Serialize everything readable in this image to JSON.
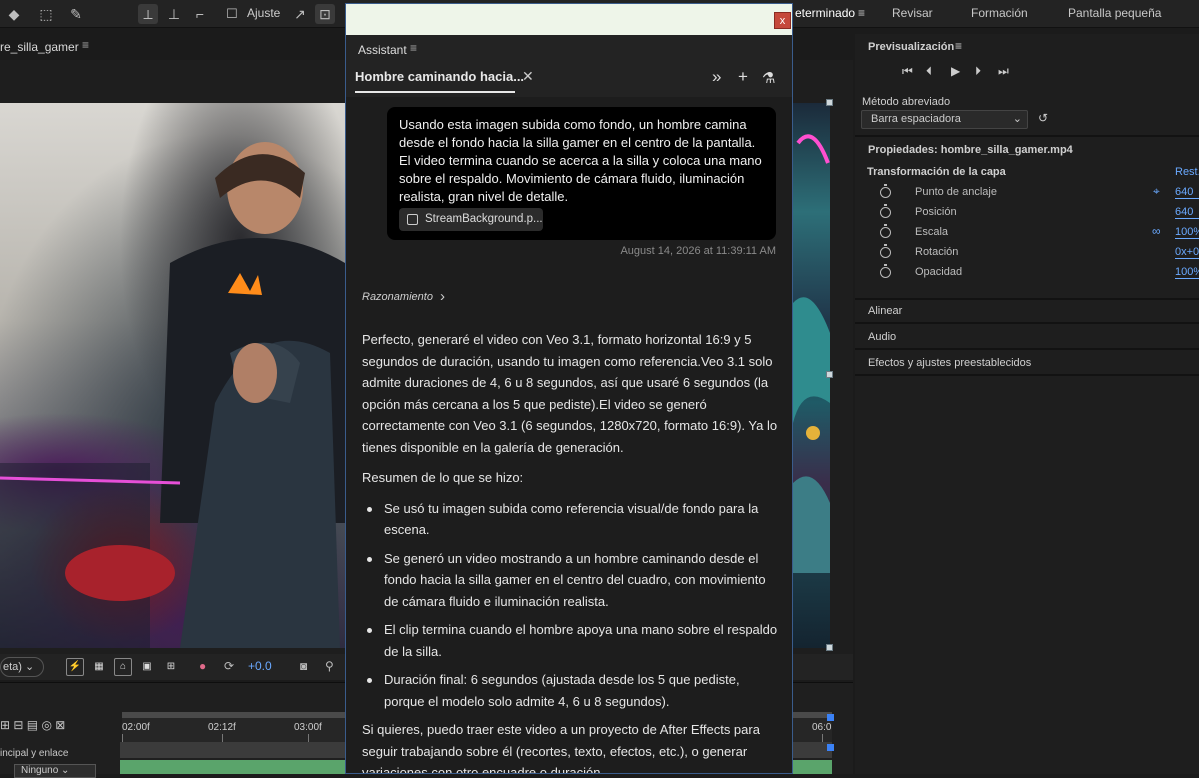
{
  "toolbar": {
    "ajuste_label": "Ajuste",
    "workspace_tabs": [
      "eterminado",
      "Revisar",
      "Formación",
      "Pantalla pequeña"
    ]
  },
  "composition": {
    "tab_label": "re_silla_gamer",
    "resolution": "eta)",
    "exposure": "+0.0"
  },
  "timeline": {
    "ticks": [
      "02:00f",
      "02:12f",
      "03:00f",
      "06:0"
    ],
    "parent_label": "incipal y enlace",
    "parent_value": "Ninguno"
  },
  "preview": {
    "title": "Previsualización",
    "shortcut_label": "Método abreviado",
    "shortcut_value": "Barra espaciadora"
  },
  "properties": {
    "title": "Propiedades: hombre_silla_gamer.mp4",
    "transform_label": "Transformación de la capa",
    "reset": "Rest.",
    "rows": [
      {
        "label": "Punto de anclaje",
        "value": "640"
      },
      {
        "label": "Posición",
        "value": "640"
      },
      {
        "label": "Escala",
        "value": "100%"
      },
      {
        "label": "Rotación",
        "value": "0x+0"
      },
      {
        "label": "Opacidad",
        "value": "100%"
      }
    ],
    "sections": [
      "Alinear",
      "Audio",
      "Efectos y ajustes preestablecidos"
    ]
  },
  "assistant": {
    "panel_name": "Assistant",
    "tab_title": "Hombre caminando hacia...",
    "close_label": "x",
    "user_message": "Usando esta imagen subida como fondo, un hombre camina desde el fondo hacia la silla gamer en el centro de la pantalla. El video termina cuando se acerca a la silla y coloca una mano sobre el respaldo. Movimiento de cámara fluido, iluminación realista, gran nivel de detalle.",
    "attachment": "StreamBackground.p...",
    "timestamp": "August 14, 2026 at 11:39:11 AM",
    "reasoning_label": "Razonamiento",
    "answer_p1": "Perfecto, generaré el video con Veo 3.1, formato horizontal 16:9 y 5 segundos de duración, usando tu imagen como referencia.Veo 3.1 solo admite duraciones de 4, 6 u 8 segundos, así que usaré 6 segundos (la opción más cercana a los 5 que pediste).El video se generó correctamente con Veo 3.1 (6 segundos, 1280x720, formato 16:9). Ya lo tienes disponible en la galería de generación.",
    "answer_p2": "Resumen de lo que se hizo:",
    "bullets": [
      "Se usó tu imagen subida como referencia visual/de fondo para la escena.",
      "Se generó un video mostrando a un hombre caminando desde el fondo hacia la silla gamer en el centro del cuadro, con movimiento de cámara fluido e iluminación realista.",
      "El clip termina cuando el hombre apoya una mano sobre el respaldo de la silla.",
      "Duración final: 6 segundos (ajustada desde los 5 que pediste, porque el modelo solo admite 4, 6 u 8 segundos)."
    ],
    "answer_p3": "Si quieres, puedo traer este video a un proyecto de After Effects para seguir trabajando sobre él (recortes, texto, efectos, etc.), o generar variaciones con otro encuadre o duración."
  }
}
